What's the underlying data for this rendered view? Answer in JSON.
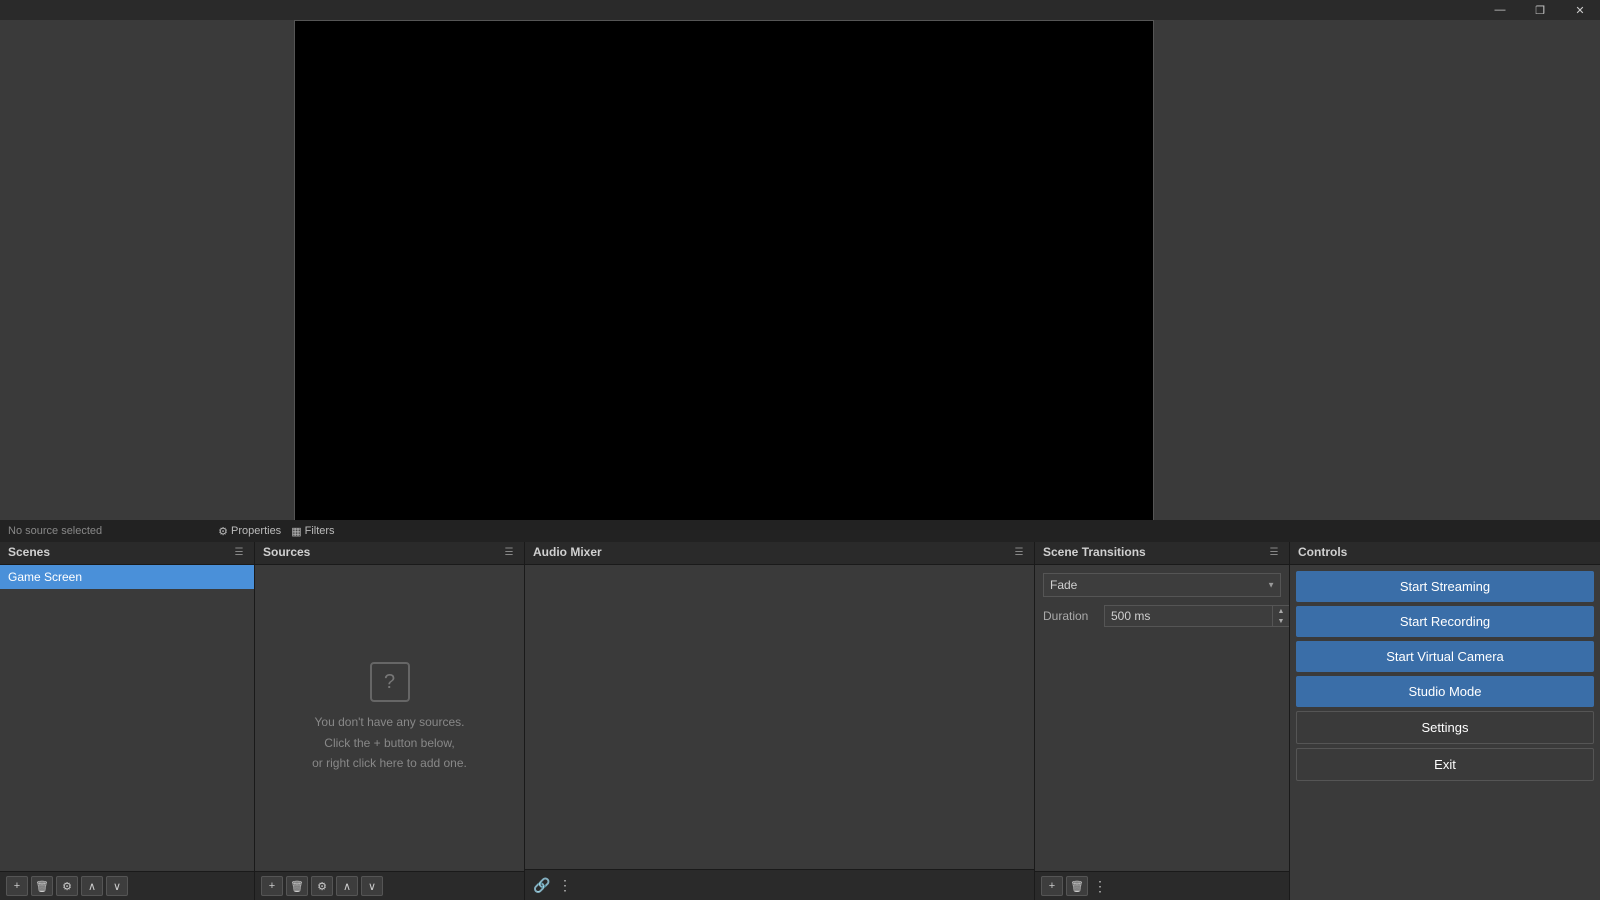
{
  "titlebar": {
    "minimize_label": "—",
    "restore_label": "❐",
    "close_label": "✕"
  },
  "status_bar": {
    "no_source": "No source selected"
  },
  "panels": {
    "properties_btn": "Properties",
    "filters_btn": "Filters"
  },
  "scenes": {
    "title": "Scenes",
    "items": [
      {
        "label": "Game Screen"
      }
    ]
  },
  "sources": {
    "title": "Sources",
    "empty_icon": "?",
    "empty_line1": "You don't have any sources.",
    "empty_line2": "Click the + button below,",
    "empty_line3": "or right click here to add one."
  },
  "audio_mixer": {
    "title": "Audio Mixer"
  },
  "scene_transitions": {
    "title": "Scene Transitions",
    "fade_label": "Fade",
    "duration_label": "Duration",
    "duration_value": "500 ms"
  },
  "controls": {
    "title": "Controls",
    "start_streaming": "Start Streaming",
    "start_recording": "Start Recording",
    "start_virtual_camera": "Start Virtual Camera",
    "studio_mode": "Studio Mode",
    "settings": "Settings",
    "exit": "Exit"
  }
}
